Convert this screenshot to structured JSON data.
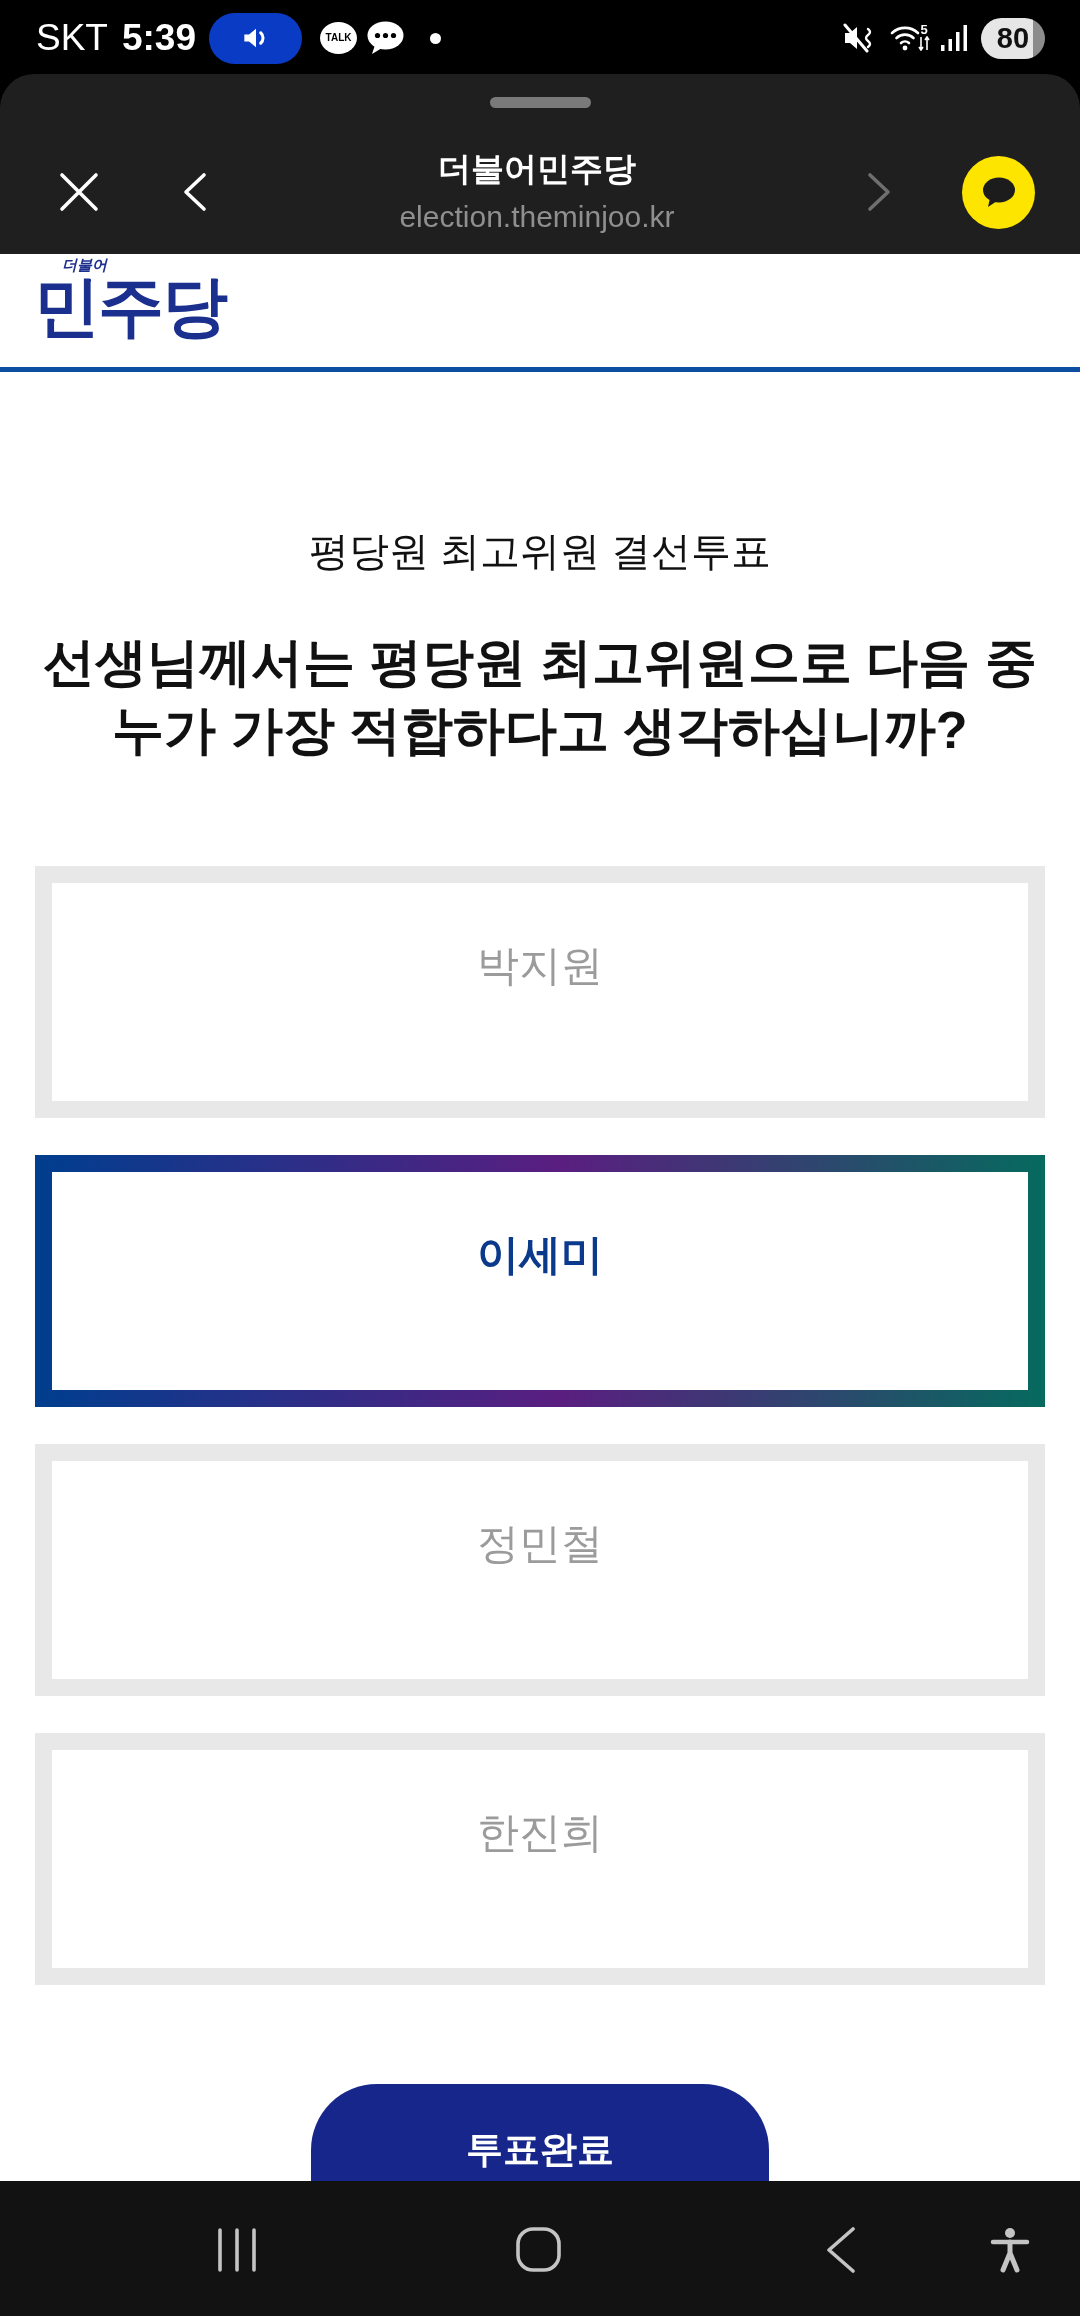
{
  "status_bar": {
    "carrier": "SKT",
    "time": "5:39",
    "notification_label": "TALK",
    "wifi_band": "5",
    "battery": "80"
  },
  "browser_bar": {
    "title": "더불어민주당",
    "url": "election.theminjoo.kr"
  },
  "site_header": {
    "logo_small": "더불어",
    "logo": "민주당"
  },
  "ballot": {
    "heading": "평당원 최고위원 결선투표",
    "question": "선생님께서는 평당원 최고위원으로 다음 중 누가 가장 적합하다고 생각하십니까?",
    "options": [
      {
        "label": "박지원",
        "selected": false
      },
      {
        "label": "이세미",
        "selected": true
      },
      {
        "label": "정민철",
        "selected": false
      },
      {
        "label": "한진희",
        "selected": false
      }
    ]
  },
  "submit_button": {
    "label": "투표완료"
  }
}
